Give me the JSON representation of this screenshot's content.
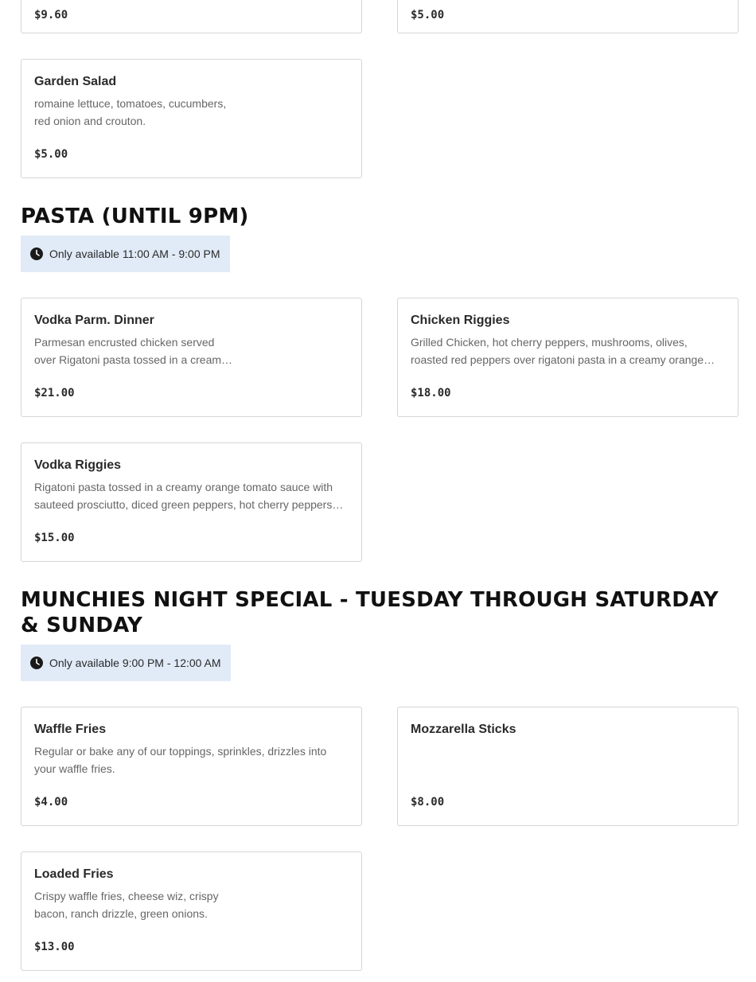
{
  "top_cards": [
    {
      "price": "$9.60"
    },
    {
      "price": "$5.00"
    }
  ],
  "sections": [
    {
      "items": [
        {
          "name": "Garden Salad",
          "desc": "romaine lettuce, tomatoes, cucumbers, red onion and crouton.",
          "price": "$5.00"
        }
      ]
    },
    {
      "title": "PASTA (UNTIL 9PM)",
      "availability": "Only available 11:00 AM - 9:00 PM",
      "items": [
        {
          "name": "Vodka Parm. Dinner",
          "desc": "Parmesan encrusted chicken served over Rigatoni pasta tossed in a cream…",
          "price": "$21.00"
        },
        {
          "name": "Chicken Riggies",
          "desc": "Grilled Chicken, hot cherry peppers, mushrooms, olives, roasted red peppers over rigatoni pasta in a creamy orange…",
          "price": "$18.00"
        },
        {
          "name": "Vodka Riggies",
          "desc": "Rigatoni pasta tossed in a creamy orange tomato sauce with sauteed prosciutto, diced green peppers, hot cherry peppers…",
          "price": "$15.00"
        }
      ]
    },
    {
      "title": "MUNCHIES NIGHT SPECIAL - TUESDAY THROUGH SATURDAY & SUNDAY",
      "availability": "Only available 9:00 PM - 12:00 AM",
      "items": [
        {
          "name": "Waffle Fries",
          "desc": "Regular or bake any of our toppings, sprinkles, drizzles into your waffle fries.",
          "price": "$4.00"
        },
        {
          "name": "Mozzarella Sticks",
          "desc": "",
          "price": "$8.00"
        },
        {
          "name": "Loaded Fries",
          "desc": "Crispy waffle fries, cheese wiz, crispy bacon, ranch drizzle, green onions.",
          "price": "$13.00"
        }
      ]
    }
  ]
}
